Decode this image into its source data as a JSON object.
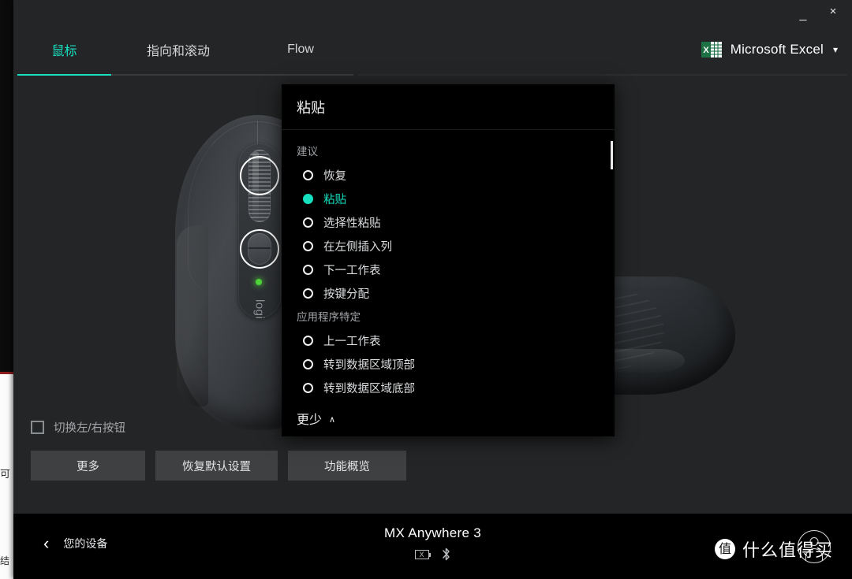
{
  "window": {
    "minimize_label": "_",
    "close_label": "×"
  },
  "header": {
    "tabs": [
      {
        "label": "鼠标",
        "active": true
      },
      {
        "label": "指向和滚动",
        "active": false
      },
      {
        "label": "Flow",
        "active": false
      }
    ],
    "app_selector": {
      "icon": "excel-icon",
      "icon_letter": "X",
      "name": "Microsoft Excel",
      "chevron": "▾"
    }
  },
  "stage": {
    "mouse_brand_text": "logi",
    "swap_buttons": {
      "label": "切换左/右按钮",
      "checked": false
    },
    "action_buttons": [
      {
        "label": "更多"
      },
      {
        "label": "恢复默认设置"
      },
      {
        "label": "功能概览"
      }
    ]
  },
  "popup": {
    "title": "粘贴",
    "groups": [
      {
        "label": "建议",
        "options": [
          {
            "label": "恢复",
            "selected": false
          },
          {
            "label": "粘贴",
            "selected": true
          },
          {
            "label": "选择性粘贴",
            "selected": false
          },
          {
            "label": "在左侧插入列",
            "selected": false
          },
          {
            "label": "下一工作表",
            "selected": false
          },
          {
            "label": "按键分配",
            "selected": false
          }
        ]
      },
      {
        "label": "应用程序特定",
        "options": [
          {
            "label": "上一工作表",
            "selected": false
          },
          {
            "label": "转到数据区域顶部",
            "selected": false
          },
          {
            "label": "转到数据区域底部",
            "selected": false
          }
        ]
      }
    ],
    "footer": {
      "less_label": "更少",
      "chevron": "∧"
    }
  },
  "bottom": {
    "back_chevron": "‹",
    "back_label": "您的设备",
    "device_name": "MX Anywhere 3",
    "battery_state": "X",
    "bluetooth_glyph": "ᛦ"
  },
  "watermark": {
    "logo_char": "值",
    "text": "什么值得买"
  },
  "colors": {
    "accent": "#16e0c0",
    "window_bg": "#242526",
    "popup_bg": "#000000",
    "button_bg": "#3e4042",
    "excel_green": "#1e7145"
  }
}
